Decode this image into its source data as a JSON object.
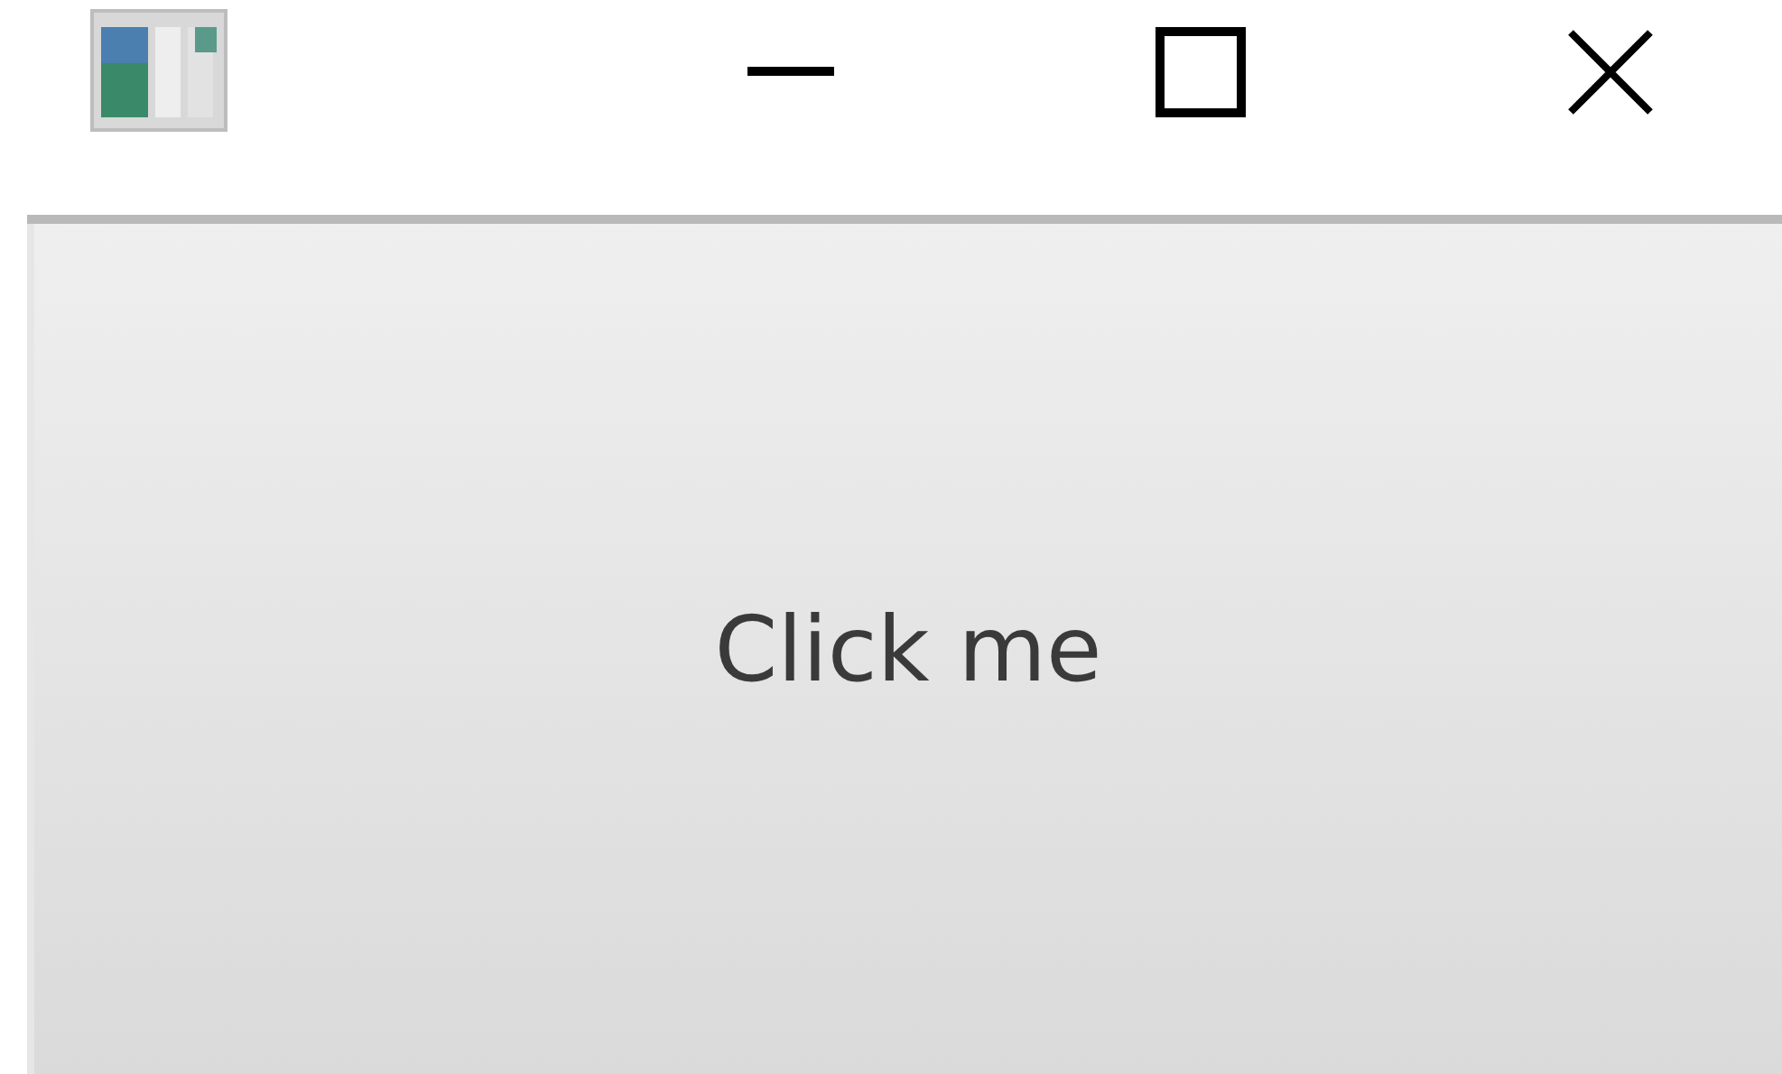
{
  "button": {
    "label": "Click me"
  }
}
